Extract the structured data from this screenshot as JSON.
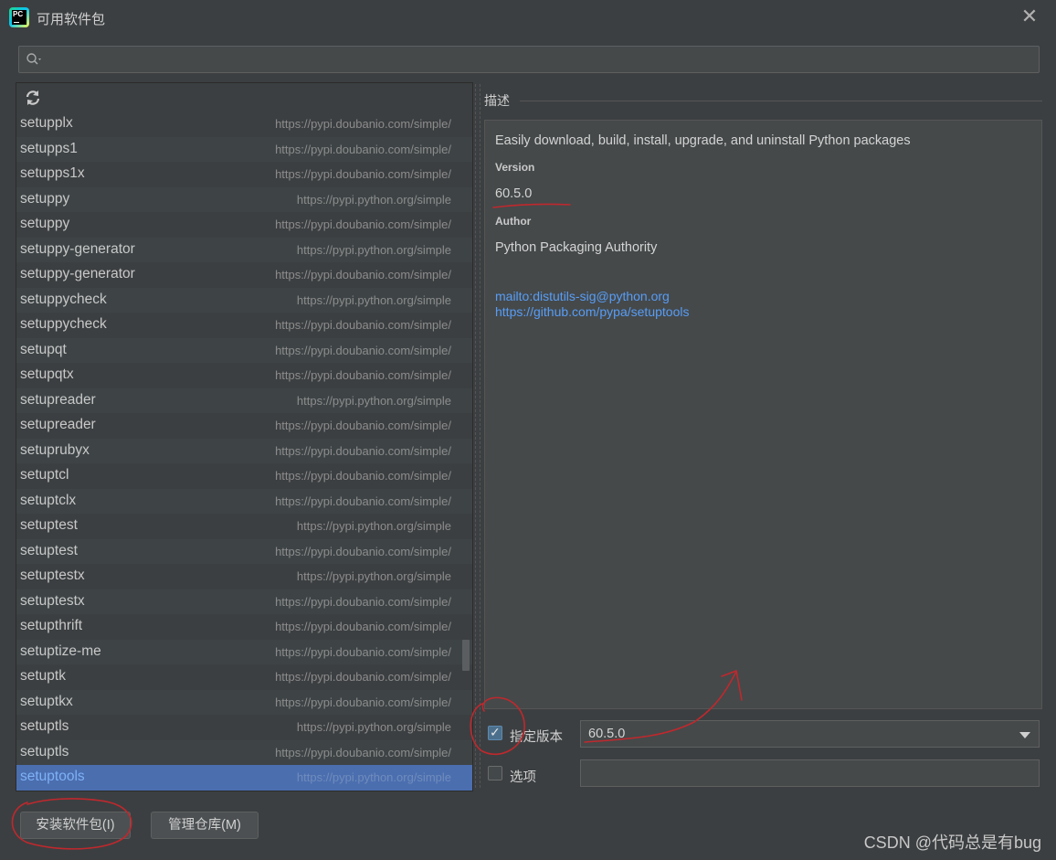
{
  "window": {
    "title": "可用软件包",
    "close_glyph": "✕"
  },
  "search": {
    "value": "",
    "placeholder": ""
  },
  "packages": [
    {
      "name": "setupplx",
      "repo": "https://pypi.doubanio.com/simple/"
    },
    {
      "name": "setupps1",
      "repo": "https://pypi.doubanio.com/simple/"
    },
    {
      "name": "setupps1x",
      "repo": "https://pypi.doubanio.com/simple/"
    },
    {
      "name": "setuppy",
      "repo": "https://pypi.python.org/simple"
    },
    {
      "name": "setuppy",
      "repo": "https://pypi.doubanio.com/simple/"
    },
    {
      "name": "setuppy-generator",
      "repo": "https://pypi.python.org/simple"
    },
    {
      "name": "setuppy-generator",
      "repo": "https://pypi.doubanio.com/simple/"
    },
    {
      "name": "setuppycheck",
      "repo": "https://pypi.python.org/simple"
    },
    {
      "name": "setuppycheck",
      "repo": "https://pypi.doubanio.com/simple/"
    },
    {
      "name": "setupqt",
      "repo": "https://pypi.doubanio.com/simple/"
    },
    {
      "name": "setupqtx",
      "repo": "https://pypi.doubanio.com/simple/"
    },
    {
      "name": "setupreader",
      "repo": "https://pypi.python.org/simple"
    },
    {
      "name": "setupreader",
      "repo": "https://pypi.doubanio.com/simple/"
    },
    {
      "name": "setuprubyx",
      "repo": "https://pypi.doubanio.com/simple/"
    },
    {
      "name": "setuptcl",
      "repo": "https://pypi.doubanio.com/simple/"
    },
    {
      "name": "setuptclx",
      "repo": "https://pypi.doubanio.com/simple/"
    },
    {
      "name": "setuptest",
      "repo": "https://pypi.python.org/simple"
    },
    {
      "name": "setuptest",
      "repo": "https://pypi.doubanio.com/simple/"
    },
    {
      "name": "setuptestx",
      "repo": "https://pypi.python.org/simple"
    },
    {
      "name": "setuptestx",
      "repo": "https://pypi.doubanio.com/simple/"
    },
    {
      "name": "setupthrift",
      "repo": "https://pypi.doubanio.com/simple/"
    },
    {
      "name": "setuptize-me",
      "repo": "https://pypi.doubanio.com/simple/"
    },
    {
      "name": "setuptk",
      "repo": "https://pypi.doubanio.com/simple/"
    },
    {
      "name": "setuptkx",
      "repo": "https://pypi.doubanio.com/simple/"
    },
    {
      "name": "setuptls",
      "repo": "https://pypi.python.org/simple"
    },
    {
      "name": "setuptls",
      "repo": "https://pypi.doubanio.com/simple/"
    },
    {
      "name": "setuptools",
      "repo": "https://pypi.python.org/simple",
      "selected": true
    }
  ],
  "description": {
    "header": "描述",
    "summary": "Easily download, build, install, upgrade, and uninstall Python packages",
    "version_label": "Version",
    "version": "60.5.0",
    "author_label": "Author",
    "author": "Python Packaging Authority",
    "links": [
      "mailto:distutils-sig@python.org",
      "https://github.com/pypa/setuptools"
    ]
  },
  "options": {
    "specify_version_label": "指定版本",
    "specify_version_checked": true,
    "version_value": "60.5.0",
    "options_label": "选项",
    "options_checked": false,
    "options_value": ""
  },
  "buttons": {
    "install": "安装软件包(I)",
    "manage": "管理仓库(M)"
  },
  "watermark": "CSDN @代码总是有bug",
  "colors": {
    "background": "#3c3f41",
    "selection": "#4b6eaf",
    "link": "#589df6",
    "annotation": "#c0282d"
  }
}
